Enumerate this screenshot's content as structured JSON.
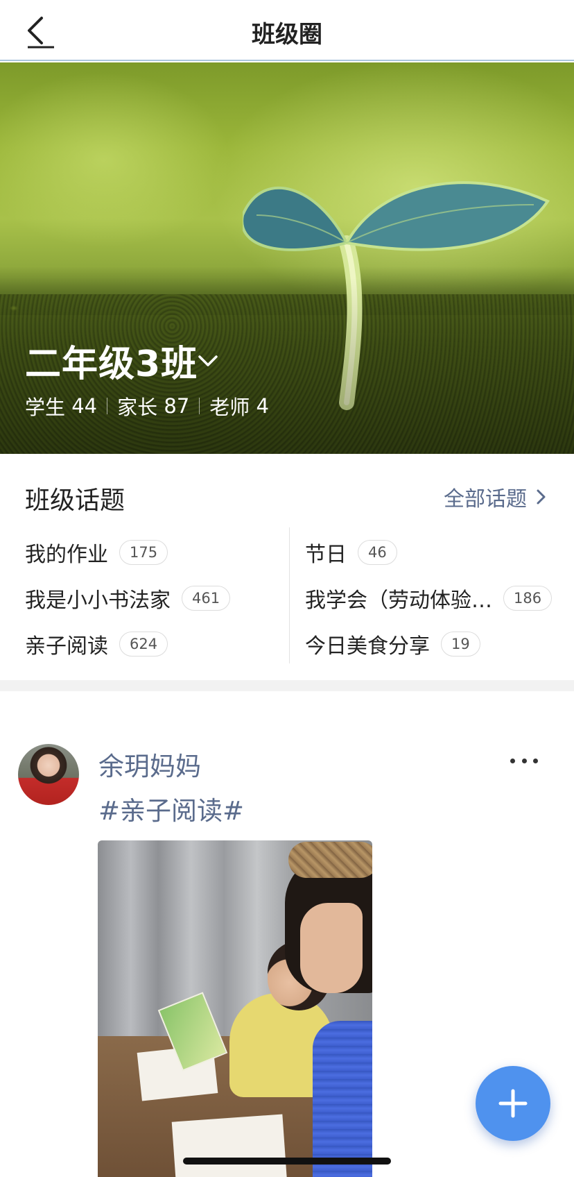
{
  "navbar": {
    "title": "班级圈",
    "back_icon": "back-arrow-icon"
  },
  "hero": {
    "class_name": "二年级3班",
    "stats": [
      {
        "label": "学生",
        "count": "44"
      },
      {
        "label": "家长",
        "count": "87"
      },
      {
        "label": "老师",
        "count": "4"
      }
    ]
  },
  "topics": {
    "title": "班级话题",
    "all_link": "全部话题",
    "left": [
      {
        "label": "我的作业",
        "count": "175"
      },
      {
        "label": "我是小小书法家",
        "count": "461"
      },
      {
        "label": "亲子阅读",
        "count": "624"
      }
    ],
    "right": [
      {
        "label": "节日",
        "count": "46"
      },
      {
        "label": "我学会（劳动体验…",
        "count": "186"
      },
      {
        "label": "今日美食分享",
        "count": "19"
      }
    ]
  },
  "post": {
    "author": "余玥妈妈",
    "hashtag": "#亲子阅读#"
  },
  "colors": {
    "accent": "#5a6b8c",
    "fab": "#4f92ee"
  }
}
